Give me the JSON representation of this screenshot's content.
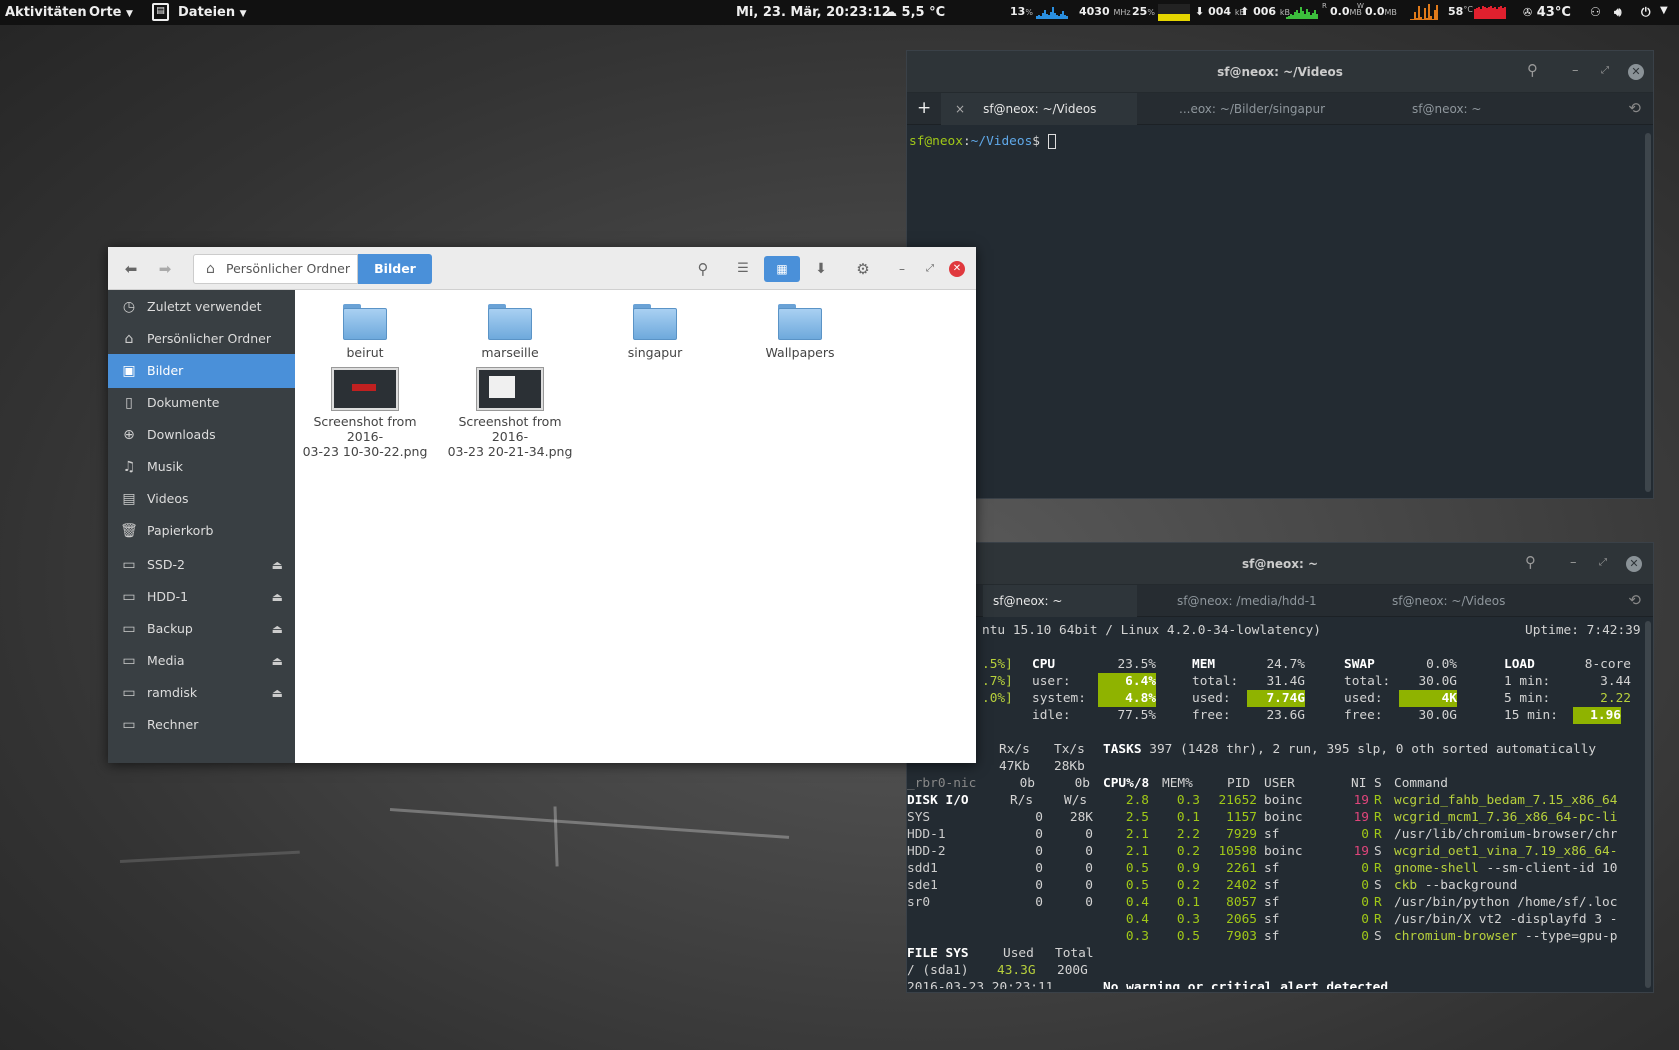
{
  "topbar": {
    "activities": "Aktivitäten",
    "places": "Orte",
    "app_menu": "Dateien",
    "clock": "Mi, 23. Mär, 20:23:12",
    "weather": "5,5 °C",
    "cpu_percent": "13",
    "cpu_freq": "4030",
    "cpu_freq_unit": "MHz",
    "mem_percent": "25",
    "net_down": "004",
    "net_up": "006",
    "net_unit": "kB",
    "disk_read": "0.0",
    "disk_write": "0.0",
    "disk_unit": "MB",
    "disk_r_label": "R",
    "disk_w_label": "W",
    "cpu_temp": "58",
    "temp_unit": "°C",
    "gpu_temp": "43°C"
  },
  "terminal_top": {
    "title": "sf@neox: ~/Videos",
    "tabs": [
      {
        "label": "sf@neox: ~/Videos",
        "close": "×"
      },
      {
        "label": "...eox: ~/Bilder/singapur"
      },
      {
        "label": "sf@neox: ~"
      }
    ],
    "add_tab": "+",
    "prompt_user": "sf@neox",
    "prompt_sep": ":",
    "prompt_path": "~/Videos",
    "prompt_end": "$"
  },
  "terminal_bottom": {
    "title": "sf@neox: ~",
    "tabs": [
      {
        "label": "sf@neox: ~"
      },
      {
        "label": "sf@neox: /media/hdd-1"
      },
      {
        "label": "sf@neox: ~/Videos"
      }
    ],
    "glances": {
      "system": "ntu 15.10 64bit / Linux 4.2.0-34-lowlatency)",
      "uptime_label": "Uptime:",
      "uptime": "7:42:39",
      "cpu_bars": [
        ".5%]",
        ".7%]",
        ".0%]"
      ],
      "cpu": {
        "label": "CPU",
        "total": "23.5%",
        "user_label": "user:",
        "user": "6.4%",
        "system_label": "system:",
        "system": "4.8%",
        "idle_label": "idle:",
        "idle": "77.5%"
      },
      "mem": {
        "label": "MEM",
        "total_pct": "24.7%",
        "total_label": "total:",
        "total": "31.4G",
        "used_label": "used:",
        "used": "7.74G",
        "free_label": "free:",
        "free": "23.6G"
      },
      "swap": {
        "label": "SWAP",
        "total_pct": "0.0%",
        "total_label": "total:",
        "total": "30.0G",
        "used_label": "used:",
        "used": "4K",
        "free_label": "free:",
        "free": "30.0G"
      },
      "load": {
        "label": "LOAD",
        "cores": "8-core",
        "min1_label": "1 min:",
        "min1": "3.44",
        "min5_label": "5 min:",
        "min5": "2.22",
        "min15_label": "15 min:",
        "min15": "1.96"
      },
      "net": {
        "rx_label": "Rx/s",
        "tx_label": "Tx/s",
        "row1_rx": "47Kb",
        "row1_tx": "28Kb",
        "row2_name": "_rbr0-nic",
        "row2_rx": "0b",
        "row2_tx": "0b"
      },
      "tasks_label": "TASKS",
      "tasks": "397 (1428 thr), 2 run, 395 slp, 0 oth sorted automatically",
      "proc_header": {
        "cpu": "CPU%/8",
        "mem": "MEM%",
        "pid": "PID",
        "user": "USER",
        "ni": "NI",
        "s": "S",
        "cmd": "Command"
      },
      "procs": [
        {
          "cpu": "2.8",
          "mem": "0.3",
          "pid": "21652",
          "user": "boinc",
          "ni": "19",
          "s": "R",
          "cmd": "wcgrid_fahb_bedam_7.15_x86_64",
          "args": ""
        },
        {
          "cpu": "2.5",
          "mem": "0.1",
          "pid": "1157",
          "user": "boinc",
          "ni": "19",
          "s": "R",
          "cmd": "wcgrid_mcm1_7.36_x86_64-pc-li",
          "args": ""
        },
        {
          "cpu": "2.1",
          "mem": "2.2",
          "pid": "7929",
          "user": "sf",
          "ni": "0",
          "s": "R",
          "cmd": "/usr/lib/chromium-browser/chr",
          "args": ""
        },
        {
          "cpu": "2.1",
          "mem": "0.2",
          "pid": "10598",
          "user": "boinc",
          "ni": "19",
          "s": "S",
          "cmd": "wcgrid_oet1_vina_7.19_x86_64-",
          "args": ""
        },
        {
          "cpu": "0.5",
          "mem": "0.9",
          "pid": "2261",
          "user": "sf",
          "ni": "0",
          "s": "R",
          "cmd": "gnome-shell",
          "args": " --sm-client-id 10"
        },
        {
          "cpu": "0.5",
          "mem": "0.2",
          "pid": "2402",
          "user": "sf",
          "ni": "0",
          "s": "S",
          "cmd": "ckb",
          "args": " --background"
        },
        {
          "cpu": "0.4",
          "mem": "0.1",
          "pid": "8057",
          "user": "sf",
          "ni": "0",
          "s": "R",
          "cmd": "/usr/bin/python",
          "args": " /home/sf/.loc"
        },
        {
          "cpu": "0.4",
          "mem": "0.3",
          "pid": "2065",
          "user": "sf",
          "ni": "0",
          "s": "R",
          "cmd": "/usr/bin/X",
          "args": " vt2 -displayfd 3 -"
        },
        {
          "cpu": "0.3",
          "mem": "0.5",
          "pid": "7903",
          "user": "sf",
          "ni": "0",
          "s": "S",
          "cmd": "chromium-browser",
          "args": " --type=gpu-p"
        }
      ],
      "diskio_label": "DISK I/O",
      "diskio_r": "R/s",
      "diskio_w": "W/s",
      "disks": [
        {
          "name": "SYS",
          "r": "0",
          "w": "28K"
        },
        {
          "name": "HDD-1",
          "r": "0",
          "w": "0"
        },
        {
          "name": "HDD-2",
          "r": "0",
          "w": "0"
        },
        {
          "name": "sdd1",
          "r": "0",
          "w": "0"
        },
        {
          "name": "sde1",
          "r": "0",
          "w": "0"
        },
        {
          "name": "sr0",
          "r": "0",
          "w": "0"
        }
      ],
      "fs_label": "FILE SYS",
      "fs_used_label": "Used",
      "fs_total_label": "Total",
      "fs_name": "/ (sda1)",
      "fs_used": "43.3G",
      "fs_total": "200G",
      "timestamp": "2016-03-23 20:23:11",
      "alert": "No warning or critical alert detected"
    }
  },
  "file_manager": {
    "crumb_home": "Persönlicher Ordner",
    "crumb_current": "Bilder",
    "sidebar": [
      {
        "label": "Zuletzt verwendet",
        "icon": "clock-icon"
      },
      {
        "label": "Persönlicher Ordner",
        "icon": "home-icon"
      },
      {
        "label": "Bilder",
        "icon": "pictures-icon",
        "selected": true
      },
      {
        "label": "Dokumente",
        "icon": "document-icon"
      },
      {
        "label": "Downloads",
        "icon": "download-icon"
      },
      {
        "label": "Musik",
        "icon": "music-icon"
      },
      {
        "label": "Videos",
        "icon": "video-icon"
      },
      {
        "label": "Papierkorb",
        "icon": "trash-icon"
      },
      {
        "label": "SSD-2",
        "icon": "drive-icon",
        "eject": true
      },
      {
        "label": "HDD-1",
        "icon": "drive-icon",
        "eject": true
      },
      {
        "label": "Backup",
        "icon": "drive-icon",
        "eject": true
      },
      {
        "label": "Media",
        "icon": "drive-icon",
        "eject": true
      },
      {
        "label": "ramdisk",
        "icon": "drive-icon",
        "eject": true
      },
      {
        "label": "Rechner",
        "icon": "computer-icon"
      }
    ],
    "items": [
      {
        "name": "beirut",
        "type": "folder"
      },
      {
        "name": "marseille",
        "type": "folder"
      },
      {
        "name": "singapur",
        "type": "folder"
      },
      {
        "name": "Wallpapers",
        "type": "folder"
      },
      {
        "name": "Screenshot from 2016-03-23 10-30-22.png",
        "line1": "Screenshot from 2016-",
        "line2": "03-23 10-30-22.png",
        "type": "image"
      },
      {
        "name": "Screenshot from 2016-03-23 20-21-34.png",
        "line1": "Screenshot from 2016-",
        "line2": "03-23 20-21-34.png",
        "type": "image"
      }
    ]
  },
  "colors": {
    "accent": "#4a90d9",
    "terminal_bg": "#232b32",
    "terminal_green": "#a0c818",
    "terminal_blue": "#5fa8e8",
    "close_red": "#e0393e"
  }
}
